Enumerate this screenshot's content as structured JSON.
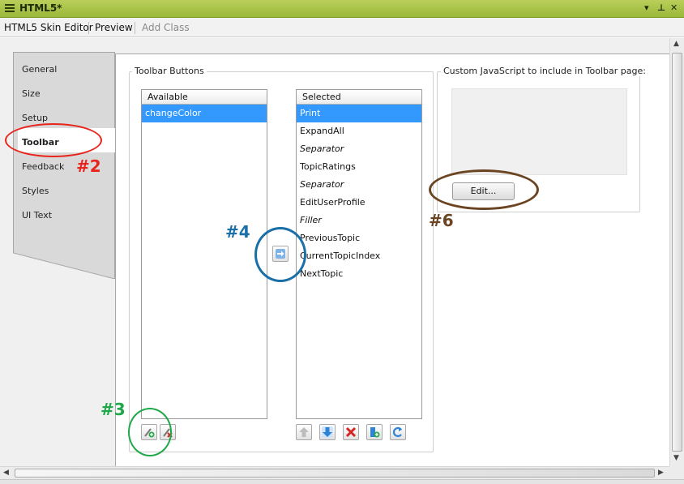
{
  "window": {
    "title": "HTML5*"
  },
  "toolbar": {
    "items": [
      "HTML5 Skin Editor",
      "Preview",
      "Add Class"
    ]
  },
  "tabs": [
    "General",
    "Size",
    "Setup",
    "Toolbar",
    "Feedback",
    "Styles",
    "UI Text"
  ],
  "active_tab": "Toolbar",
  "toolbar_buttons": {
    "group_label": "Toolbar Buttons",
    "available": {
      "header": "Available",
      "items": [
        "changeColor"
      ]
    },
    "selected": {
      "header": "Selected",
      "items": [
        "Print",
        "ExpandAll",
        "Separator",
        "TopicRatings",
        "Separator",
        "EditUserProfile",
        "Filler",
        "PreviousTopic",
        "CurrentTopicIndex",
        "NextTopic"
      ]
    }
  },
  "custom_js": {
    "group_label": "Custom JavaScript to include in Toolbar page:",
    "edit_button": "Edit..."
  },
  "annotations": [
    {
      "label": "#2",
      "color": "#e8241c"
    },
    {
      "label": "#3",
      "color": "#1fa84a"
    },
    {
      "label": "#4",
      "color": "#1a6fa8"
    },
    {
      "label": "#6",
      "color": "#6b4422"
    }
  ],
  "colors": {
    "title_bar": "#a6c043",
    "selection": "#3399ff"
  },
  "icons": [
    "menu-icon",
    "pin-icon",
    "close-icon",
    "add-icon",
    "delete-icon",
    "arrow-right-icon",
    "move-up-icon",
    "move-down-icon",
    "remove-icon",
    "insert-icon",
    "reset-icon"
  ]
}
